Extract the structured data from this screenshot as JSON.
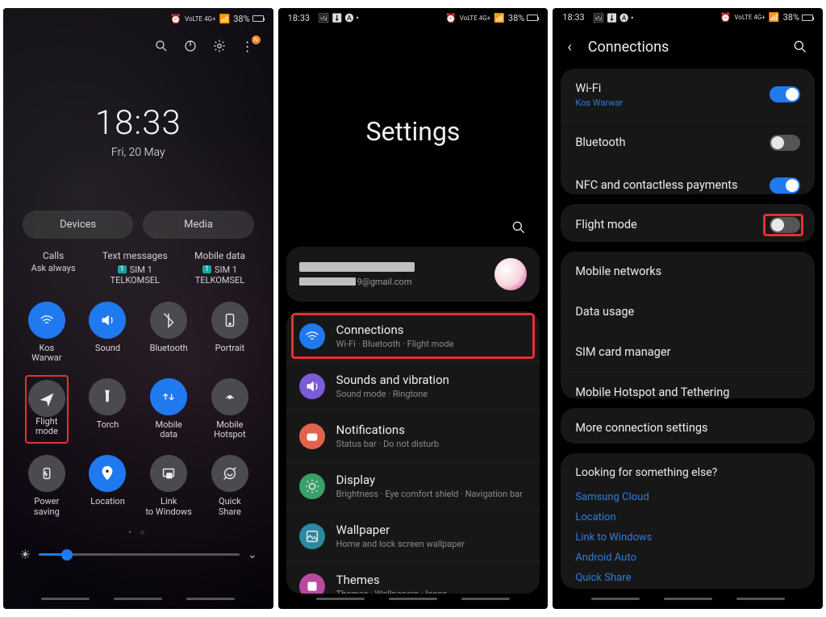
{
  "status": {
    "time": "18:33",
    "indicators": "VoLTE 4G+",
    "battery": "38%"
  },
  "panel1": {
    "clock_time": "18:33",
    "clock_date": "Fri, 20 May",
    "devices": "Devices",
    "media": "Media",
    "calls_label": "Calls",
    "calls_value": "Ask always",
    "texts_label": "Text messages",
    "sim_badge": "1",
    "sim_name": "SIM 1",
    "carrier": "TELKOMSEL",
    "data_label": "Mobile data",
    "tiles": [
      {
        "label": "Kos Warwar",
        "on": true,
        "icon": "wifi"
      },
      {
        "label": "Sound",
        "on": true,
        "icon": "sound"
      },
      {
        "label": "Bluetooth",
        "on": false,
        "icon": "bt"
      },
      {
        "label": "Portrait",
        "on": false,
        "icon": "portrait"
      },
      {
        "label": "Flight mode",
        "on": false,
        "icon": "plane",
        "highlight": true
      },
      {
        "label": "Torch",
        "on": false,
        "icon": "torch"
      },
      {
        "label": "Mobile data",
        "on": true,
        "icon": "mdata"
      },
      {
        "label": "Mobile Hotspot",
        "on": false,
        "icon": "hotspot"
      },
      {
        "label": "Power saving",
        "on": false,
        "icon": "psave"
      },
      {
        "label": "Location",
        "on": true,
        "icon": "loc"
      },
      {
        "label": "Link to Windows",
        "on": false,
        "icon": "link"
      },
      {
        "label": "Quick Share",
        "on": false,
        "icon": "qshare"
      }
    ]
  },
  "panel2": {
    "title": "Settings",
    "email_suffix": "9@gmail.com",
    "rows": [
      {
        "title": "Connections",
        "sub": "Wi-Fi  ·  Bluetooth  ·  Flight mode",
        "color": "c-blue",
        "icon": "wifi",
        "highlight": true
      },
      {
        "title": "Sounds and vibration",
        "sub": "Sound mode  ·  Ringtone",
        "color": "c-purple",
        "icon": "sound"
      },
      {
        "title": "Notifications",
        "sub": "Status bar  ·  Do not disturb",
        "color": "c-red",
        "icon": "notif"
      },
      {
        "title": "Display",
        "sub": "Brightness  ·  Eye comfort shield  ·  Navigation bar",
        "color": "c-green",
        "icon": "display"
      },
      {
        "title": "Wallpaper",
        "sub": "Home and lock screen wallpaper",
        "color": "c-teal",
        "icon": "wall"
      },
      {
        "title": "Themes",
        "sub": "Themes  ·  Wallpapers  ·  Icons",
        "color": "c-pink",
        "icon": "theme"
      }
    ]
  },
  "panel3": {
    "header": "Connections",
    "group1": [
      {
        "label": "Wi-Fi",
        "sub": "Kos Warwar",
        "on": true
      },
      {
        "label": "Bluetooth",
        "on": false
      },
      {
        "label": "NFC and contactless payments",
        "on": true
      }
    ],
    "flight": {
      "label": "Flight mode",
      "on": false
    },
    "group2": [
      {
        "label": "Mobile networks"
      },
      {
        "label": "Data usage"
      },
      {
        "label": "SIM card manager"
      },
      {
        "label": "Mobile Hotspot and Tethering"
      }
    ],
    "more": "More connection settings",
    "looking": "Looking for something else?",
    "links": [
      "Samsung Cloud",
      "Location",
      "Link to Windows",
      "Android Auto",
      "Quick Share"
    ]
  }
}
